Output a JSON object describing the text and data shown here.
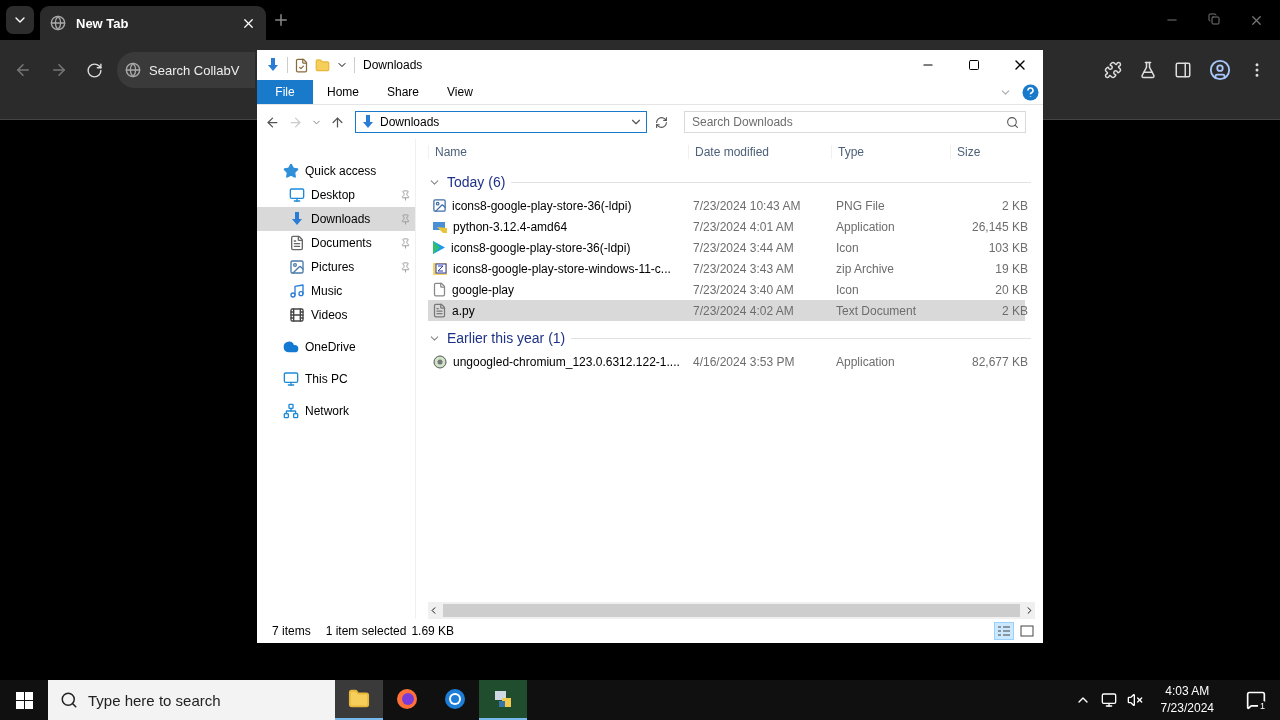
{
  "browser": {
    "tab": {
      "title": "New Tab"
    },
    "omnibox": {
      "text": "Search CollabV"
    }
  },
  "explorer": {
    "title": "Downloads",
    "file_tab": "File",
    "ribbon_tabs": [
      "Home",
      "Share",
      "View"
    ],
    "address": {
      "value": "Downloads"
    },
    "search": {
      "placeholder": "Search Downloads"
    },
    "nav": [
      {
        "label": "Quick access",
        "kind": "star",
        "selected": false,
        "children": [
          {
            "label": "Desktop",
            "kind": "desktop",
            "pinned": true,
            "selected": false
          },
          {
            "label": "Downloads",
            "kind": "downloads",
            "pinned": true,
            "selected": true
          },
          {
            "label": "Documents",
            "kind": "documents",
            "pinned": true,
            "selected": false
          },
          {
            "label": "Pictures",
            "kind": "pictures",
            "pinned": true,
            "selected": false
          },
          {
            "label": "Music",
            "kind": "music",
            "pinned": false,
            "selected": false
          },
          {
            "label": "Videos",
            "kind": "videos",
            "pinned": false,
            "selected": false
          }
        ]
      },
      {
        "label": "OneDrive",
        "kind": "cloud",
        "selected": false
      },
      {
        "label": "This PC",
        "kind": "pc",
        "selected": false
      },
      {
        "label": "Network",
        "kind": "network",
        "selected": false
      }
    ],
    "columns": [
      "Name",
      "Date modified",
      "Type",
      "Size"
    ],
    "groups": [
      {
        "title": "Today (6)",
        "expanded": true,
        "rows": [
          {
            "name": "icons8-google-play-store-36(-ldpi)",
            "date": "7/23/2024 10:43 AM",
            "type": "PNG File",
            "size": "2 KB",
            "kind": "image",
            "selected": false
          },
          {
            "name": "python-3.12.4-amd64",
            "date": "7/23/2024 4:01 AM",
            "type": "Application",
            "size": "26,145 KB",
            "kind": "installer",
            "selected": false
          },
          {
            "name": "icons8-google-play-store-36(-ldpi)",
            "date": "7/23/2024 3:44 AM",
            "type": "Icon",
            "size": "103 KB",
            "kind": "play",
            "selected": false
          },
          {
            "name": "icons8-google-play-store-windows-11-c...",
            "date": "7/23/2024 3:43 AM",
            "type": "zip Archive",
            "size": "19 KB",
            "kind": "zip",
            "selected": false
          },
          {
            "name": "google-play",
            "date": "7/23/2024 3:40 AM",
            "type": "Icon",
            "size": "20 KB",
            "kind": "blank",
            "selected": false
          },
          {
            "name": "a.py",
            "date": "7/23/2024 4:02 AM",
            "type": "Text Document",
            "size": "2 KB",
            "kind": "text",
            "selected": true
          }
        ]
      },
      {
        "title": "Earlier this year (1)",
        "expanded": true,
        "rows": [
          {
            "name": "ungoogled-chromium_123.0.6312.122-1....",
            "date": "4/16/2024 3:53 PM",
            "type": "Application",
            "size": "82,677 KB",
            "kind": "app",
            "selected": false
          }
        ]
      }
    ],
    "status": {
      "count": "7 items",
      "selection": "1 item selected",
      "size": "1.69 KB"
    }
  },
  "taskbar": {
    "search": {
      "placeholder": "Type here to search"
    },
    "apps": [
      {
        "kind": "explorer",
        "active": true
      },
      {
        "kind": "firefox",
        "active": false
      },
      {
        "kind": "chrome",
        "active": false
      },
      {
        "kind": "python",
        "active": true
      }
    ],
    "time": "4:03 AM",
    "date": "7/23/2024",
    "notifications": "1"
  }
}
